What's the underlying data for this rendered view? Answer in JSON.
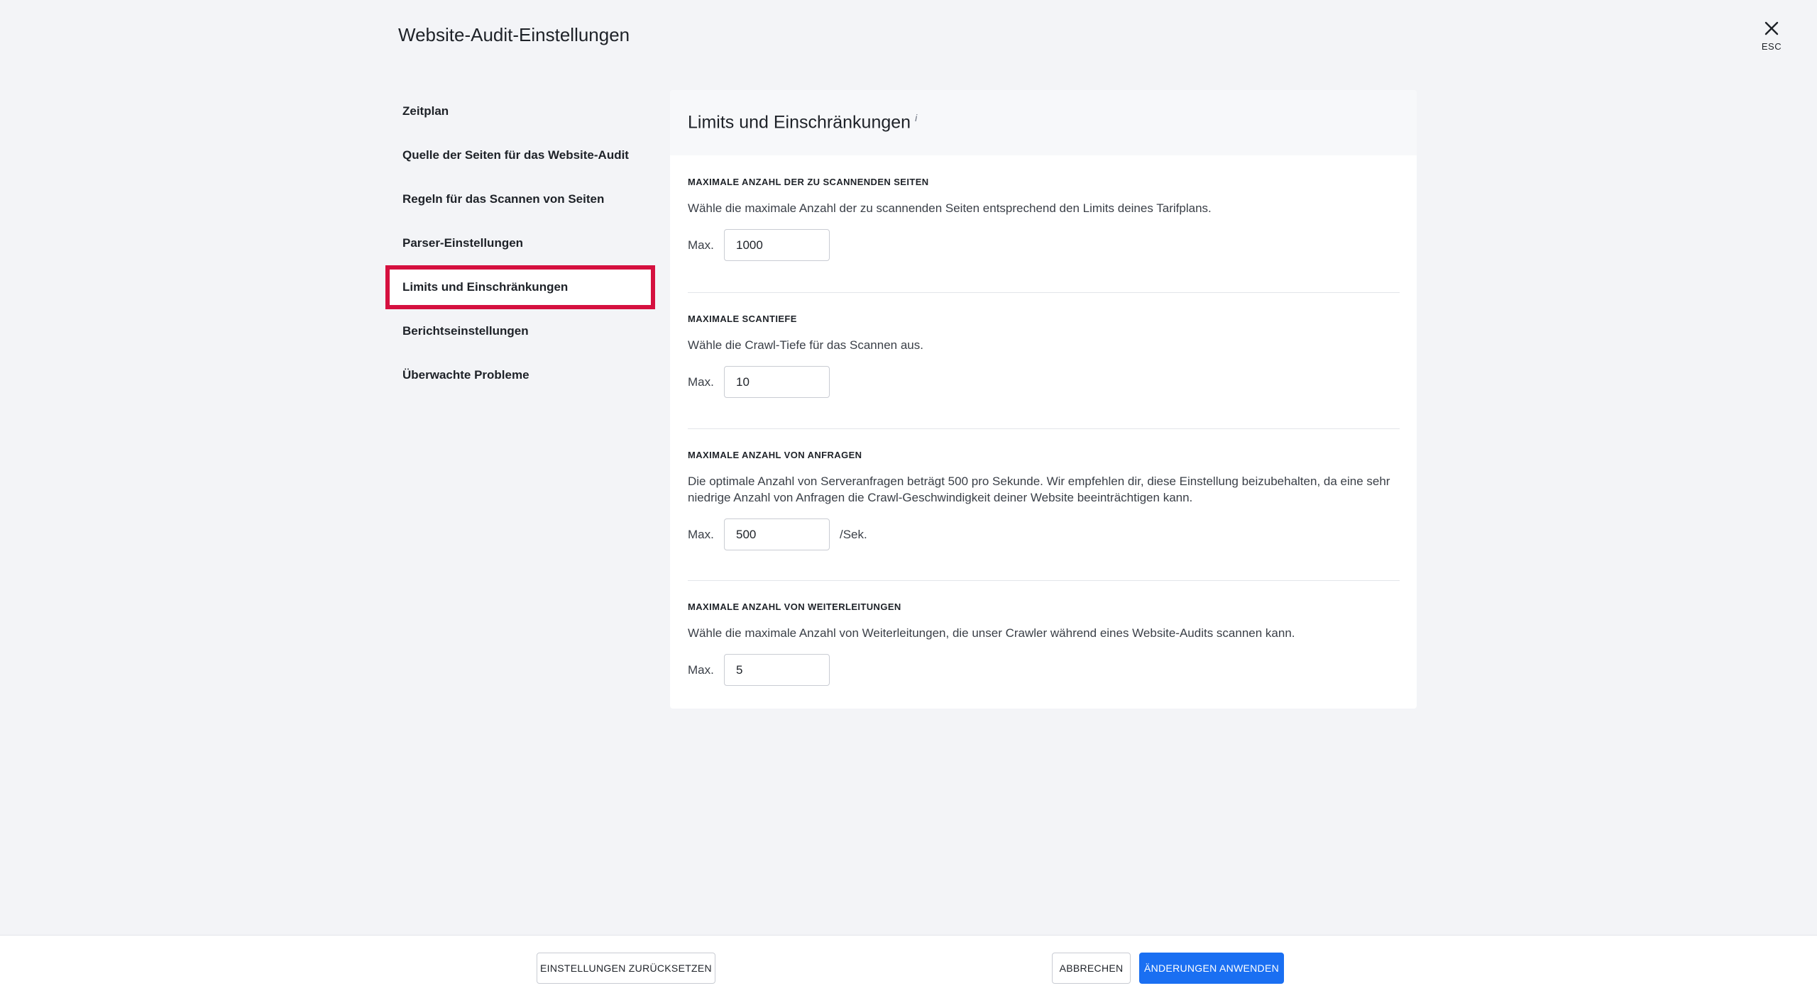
{
  "header": {
    "title": "Website-Audit-Einstellungen",
    "close_label": "ESC"
  },
  "sidebar": {
    "items": [
      {
        "label": "Zeitplan"
      },
      {
        "label": "Quelle der Seiten für das Website-Audit"
      },
      {
        "label": "Regeln für das Scannen von Seiten"
      },
      {
        "label": "Parser-Einstellungen"
      },
      {
        "label": "Limits und Einschränkungen"
      },
      {
        "label": "Berichtseinstellungen"
      },
      {
        "label": "Überwachte Probleme"
      }
    ],
    "active_index": 4
  },
  "panel": {
    "title": "Limits und Einschränkungen",
    "info_mark": "i",
    "sections": [
      {
        "label": "MAXIMALE ANZAHL DER ZU SCANNENDEN SEITEN",
        "description": "Wähle die maximale Anzahl der zu scannenden Seiten entsprechend den Limits deines Tarifplans.",
        "field_label": "Max.",
        "value": "1000",
        "unit": ""
      },
      {
        "label": "MAXIMALE SCANTIEFE",
        "description": "Wähle die Crawl-Tiefe für das Scannen aus.",
        "field_label": "Max.",
        "value": "10",
        "unit": ""
      },
      {
        "label": "MAXIMALE ANZAHL VON ANFRAGEN",
        "description": "Die optimale Anzahl von Serveranfragen beträgt 500 pro Sekunde. Wir empfehlen dir, diese Einstellung beizubehalten, da eine sehr niedrige Anzahl von Anfragen die Crawl-Geschwindigkeit deiner Website beeinträchtigen kann.",
        "field_label": "Max.",
        "value": "500",
        "unit": "/Sek."
      },
      {
        "label": "MAXIMALE ANZAHL VON WEITERLEITUNGEN",
        "description": "Wähle die maximale Anzahl von Weiterleitungen, die unser Crawler während eines Website-Audits scannen kann.",
        "field_label": "Max.",
        "value": "5",
        "unit": ""
      }
    ]
  },
  "footer": {
    "reset_label": "EINSTELLUNGEN ZURÜCKSETZEN",
    "cancel_label": "ABBRECHEN",
    "apply_label": "ÄNDERUNGEN ANWENDEN"
  },
  "colors": {
    "accent": "#1a6ff2",
    "highlight": "#d5103f",
    "background": "#f3f4f7"
  },
  "icons": {
    "close": "close-icon"
  }
}
